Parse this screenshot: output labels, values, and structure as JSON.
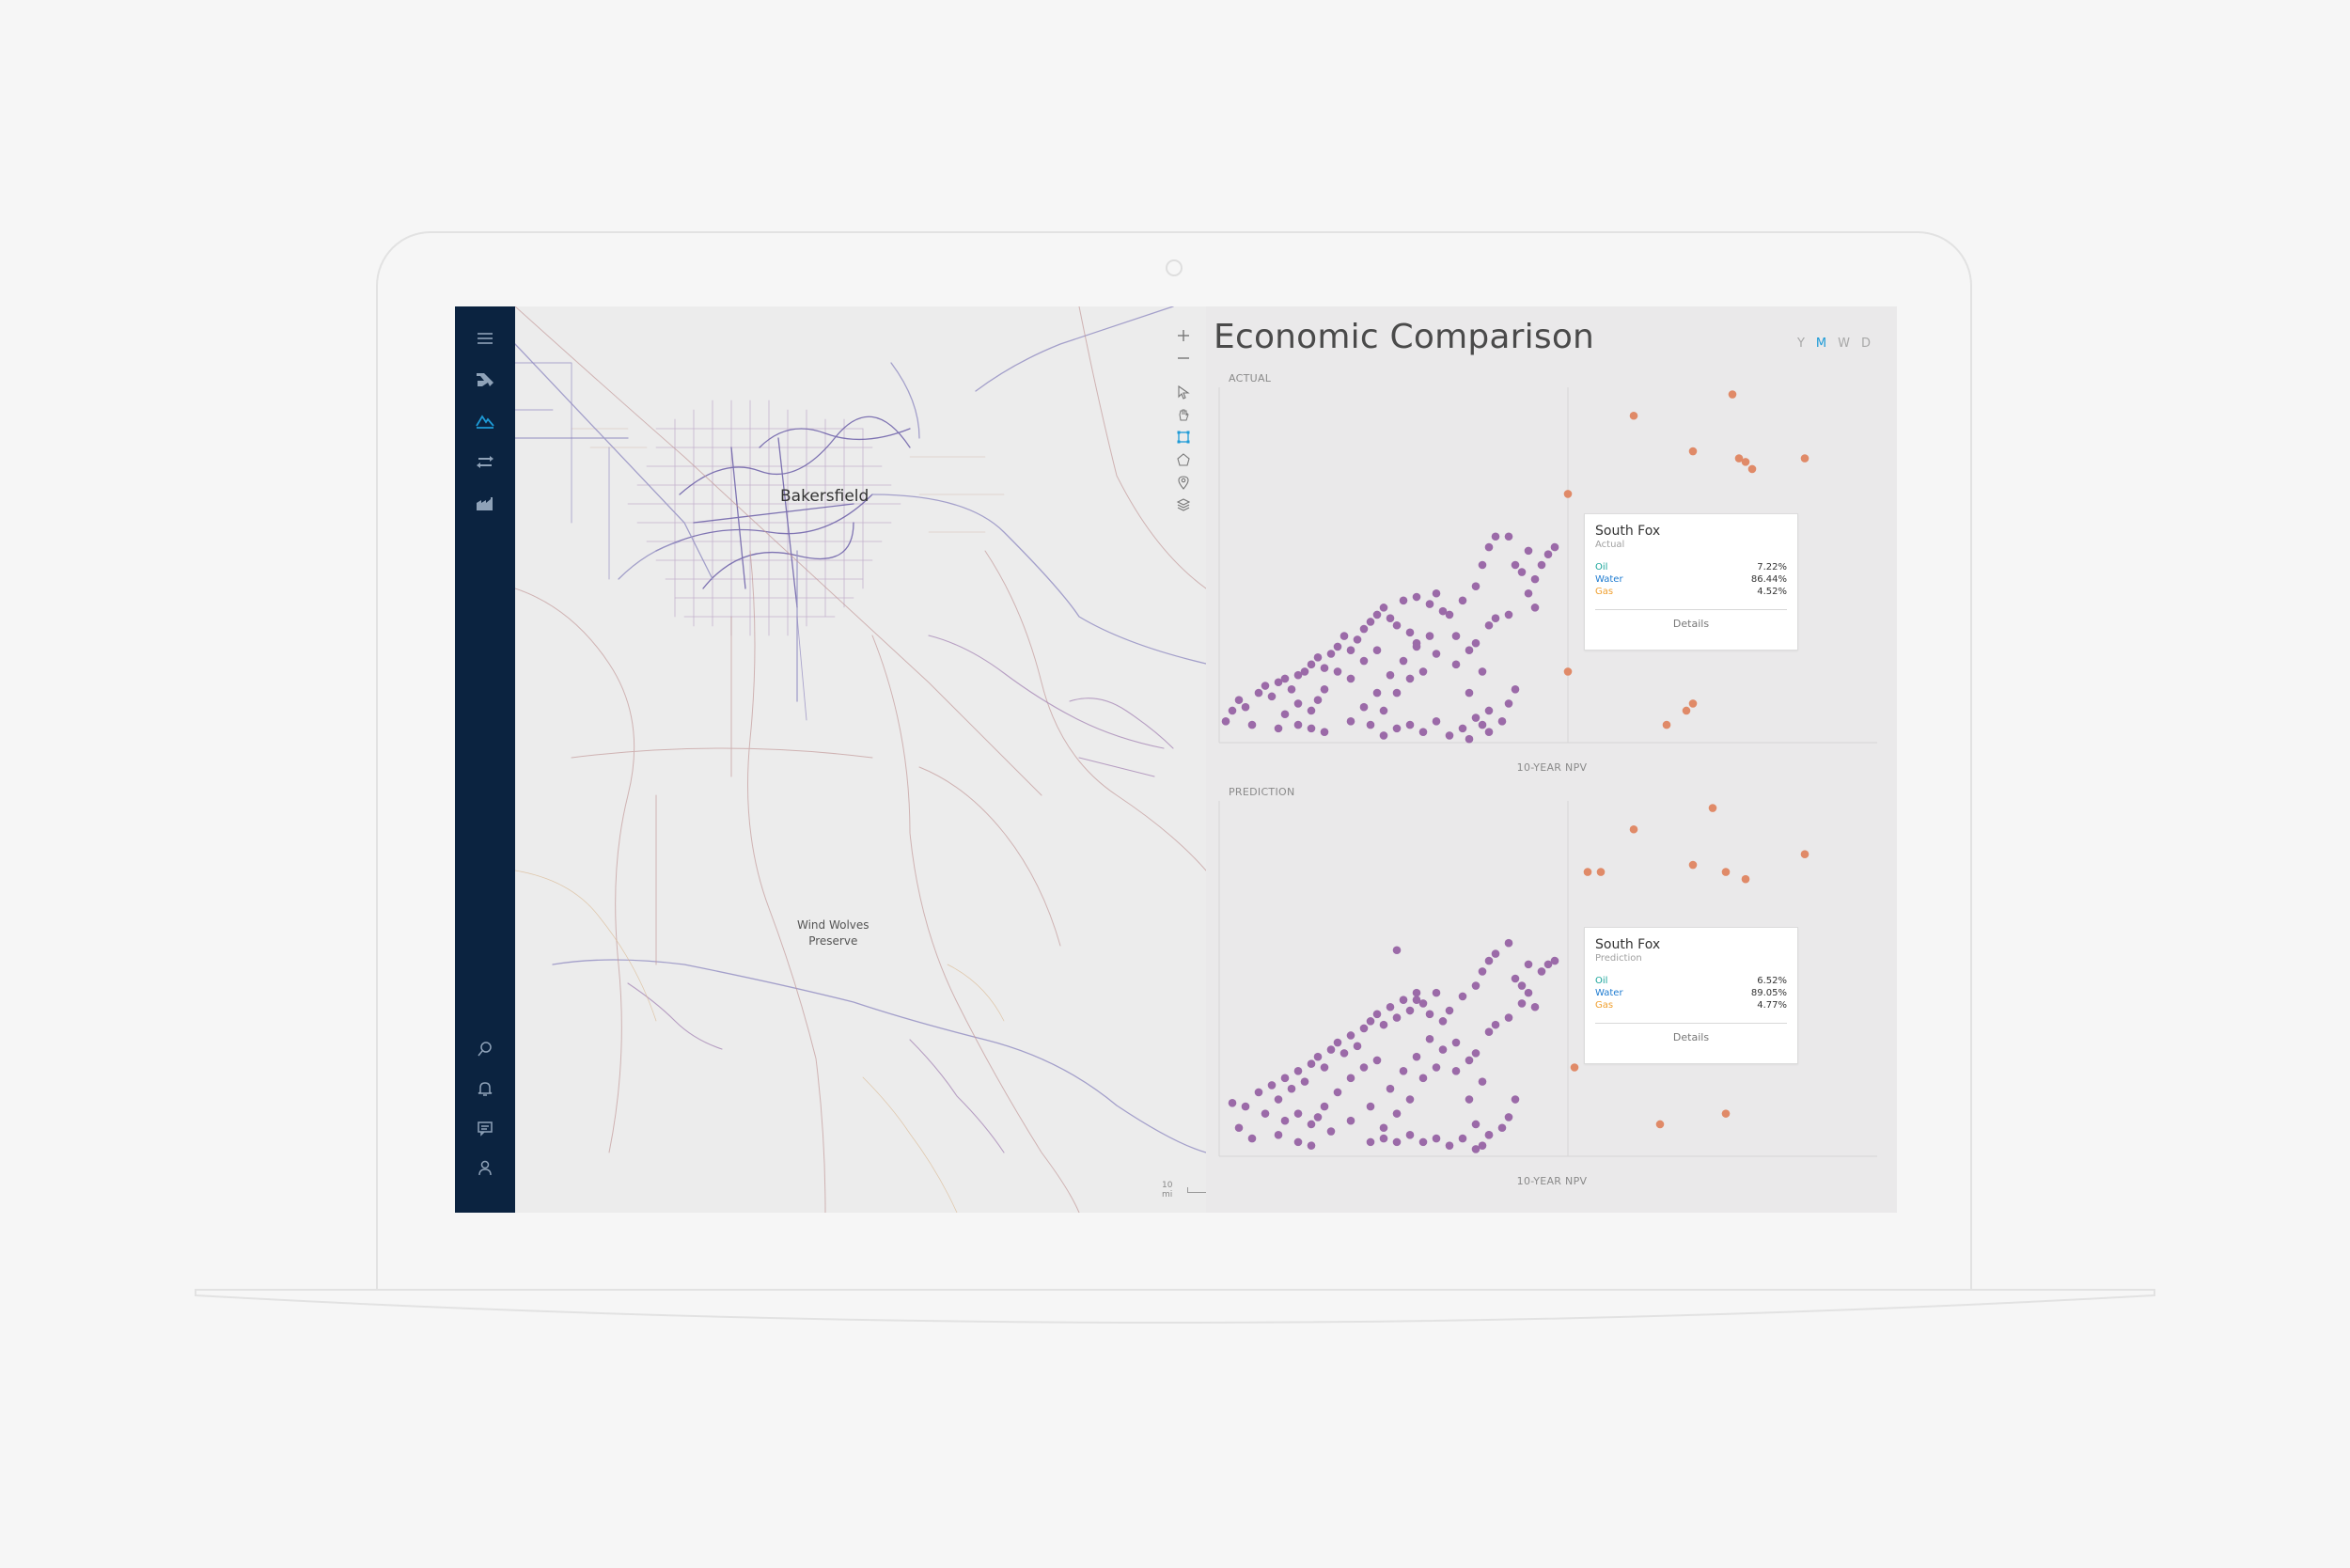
{
  "colors": {
    "sidebar_bg": "#0b2340",
    "accent": "#1e9bd7",
    "actual_dots": "#9b6aa8",
    "far_dots": "#e08a68",
    "oil": "#1aa59a",
    "water": "#1e7bd0",
    "gas": "#f0a030"
  },
  "sidebar": {
    "top_icons": [
      "menu-icon",
      "oil-rig-icon",
      "analytics-peaks-icon",
      "transfer-arrows-icon",
      "factory-icon"
    ],
    "active_icon": "analytics-peaks-icon",
    "bottom_icons": [
      "search-icon",
      "bell-icon",
      "chat-icon",
      "user-icon"
    ]
  },
  "map": {
    "city_label": "Bakersfield",
    "park_label": "Wind Wolves\nPreserve",
    "scale_label": "10 mi",
    "tools": [
      "zoom-in-icon",
      "zoom-out-icon",
      "pointer-icon",
      "pan-hand-icon",
      "rectangle-select-icon",
      "polygon-select-icon",
      "location-pin-icon",
      "layers-icon"
    ],
    "active_tool": "rectangle-select-icon"
  },
  "panel": {
    "title": "Economic Comparison",
    "periods": [
      "Y",
      "M",
      "W",
      "D"
    ],
    "active_period": "M"
  },
  "chart_data": [
    {
      "type": "scatter",
      "label": "ACTUAL",
      "xlabel": "10-YEAR NPV",
      "ylabel": "",
      "ylim": [
        0,
        100
      ],
      "xlim": [
        0,
        100
      ],
      "reference_line_x": 53,
      "points": [
        [
          1,
          6
        ],
        [
          2,
          9
        ],
        [
          5,
          5
        ],
        [
          3,
          12
        ],
        [
          6,
          14
        ],
        [
          4,
          10
        ],
        [
          7,
          16
        ],
        [
          8,
          13
        ],
        [
          9,
          17
        ],
        [
          10,
          18
        ],
        [
          11,
          15
        ],
        [
          12,
          19
        ],
        [
          13,
          20
        ],
        [
          14,
          22
        ],
        [
          15,
          24
        ],
        [
          16,
          21
        ],
        [
          17,
          25
        ],
        [
          18,
          27
        ],
        [
          19,
          30
        ],
        [
          20,
          26
        ],
        [
          21,
          29
        ],
        [
          22,
          32
        ],
        [
          23,
          34
        ],
        [
          24,
          36
        ],
        [
          25,
          38
        ],
        [
          26,
          35
        ],
        [
          27,
          33
        ],
        [
          28,
          40
        ],
        [
          29,
          31
        ],
        [
          30,
          28
        ],
        [
          24,
          26
        ],
        [
          22,
          23
        ],
        [
          20,
          18
        ],
        [
          18,
          20
        ],
        [
          16,
          15
        ],
        [
          15,
          12
        ],
        [
          14,
          9
        ],
        [
          12,
          11
        ],
        [
          10,
          8
        ],
        [
          9,
          4
        ],
        [
          12,
          5
        ],
        [
          14,
          4
        ],
        [
          16,
          3
        ],
        [
          20,
          6
        ],
        [
          22,
          10
        ],
        [
          24,
          14
        ],
        [
          26,
          19
        ],
        [
          28,
          23
        ],
        [
          30,
          27
        ],
        [
          32,
          30
        ],
        [
          33,
          25
        ],
        [
          31,
          20
        ],
        [
          29,
          18
        ],
        [
          27,
          14
        ],
        [
          25,
          9
        ],
        [
          23,
          5
        ],
        [
          25,
          2
        ],
        [
          27,
          4
        ],
        [
          29,
          5
        ],
        [
          31,
          3
        ],
        [
          33,
          6
        ],
        [
          35,
          2
        ],
        [
          37,
          4
        ],
        [
          39,
          7
        ],
        [
          41,
          9
        ],
        [
          43,
          6
        ],
        [
          44,
          11
        ],
        [
          45,
          15
        ],
        [
          40,
          20
        ],
        [
          38,
          26
        ],
        [
          36,
          30
        ],
        [
          34,
          37
        ],
        [
          32,
          39
        ],
        [
          30,
          41
        ],
        [
          33,
          42
        ],
        [
          35,
          36
        ],
        [
          37,
          40
        ],
        [
          39,
          44
        ],
        [
          40,
          50
        ],
        [
          41,
          55
        ],
        [
          42,
          58
        ],
        [
          36,
          22
        ],
        [
          38,
          14
        ],
        [
          39,
          28
        ],
        [
          41,
          33
        ],
        [
          42,
          35
        ],
        [
          44,
          36
        ],
        [
          47,
          42
        ],
        [
          48,
          46
        ],
        [
          49,
          50
        ],
        [
          50,
          53
        ],
        [
          51,
          55
        ],
        [
          47,
          54
        ],
        [
          44,
          58
        ],
        [
          45,
          50
        ],
        [
          46,
          48
        ],
        [
          48,
          38
        ],
        [
          41,
          3
        ],
        [
          40,
          5
        ],
        [
          38,
          1
        ]
      ],
      "far_points": [
        [
          53,
          70
        ],
        [
          53,
          20
        ],
        [
          63,
          92
        ],
        [
          68,
          5
        ],
        [
          72,
          82
        ],
        [
          78,
          98
        ],
        [
          79,
          80
        ],
        [
          78,
          63
        ],
        [
          80,
          79
        ],
        [
          81,
          77
        ],
        [
          89,
          80
        ],
        [
          71,
          9
        ],
        [
          72,
          11
        ]
      ],
      "tooltip": {
        "title": "South Fox",
        "subtitle": "Actual",
        "rows": [
          {
            "name": "Oil",
            "value": "7.22%"
          },
          {
            "name": "Water",
            "value": "86.44%"
          },
          {
            "name": "Gas",
            "value": "4.52%"
          }
        ],
        "action": "Details"
      }
    },
    {
      "type": "scatter",
      "label": "PREDICTION",
      "xlabel": "10-YEAR NPV",
      "ylabel": "",
      "ylim": [
        0,
        100
      ],
      "xlim": [
        0,
        100
      ],
      "reference_line_x": 53,
      "points": [
        [
          2,
          15
        ],
        [
          3,
          8
        ],
        [
          5,
          5
        ],
        [
          4,
          14
        ],
        [
          6,
          18
        ],
        [
          7,
          12
        ],
        [
          8,
          20
        ],
        [
          9,
          16
        ],
        [
          10,
          22
        ],
        [
          11,
          19
        ],
        [
          12,
          24
        ],
        [
          13,
          21
        ],
        [
          14,
          26
        ],
        [
          15,
          28
        ],
        [
          16,
          25
        ],
        [
          17,
          30
        ],
        [
          18,
          32
        ],
        [
          19,
          29
        ],
        [
          20,
          34
        ],
        [
          21,
          31
        ],
        [
          22,
          36
        ],
        [
          23,
          38
        ],
        [
          24,
          40
        ],
        [
          25,
          37
        ],
        [
          26,
          42
        ],
        [
          27,
          39
        ],
        [
          28,
          44
        ],
        [
          29,
          41
        ],
        [
          30,
          46
        ],
        [
          31,
          43
        ],
        [
          24,
          27
        ],
        [
          22,
          25
        ],
        [
          20,
          22
        ],
        [
          18,
          18
        ],
        [
          16,
          14
        ],
        [
          15,
          11
        ],
        [
          14,
          9
        ],
        [
          12,
          12
        ],
        [
          10,
          10
        ],
        [
          9,
          6
        ],
        [
          12,
          4
        ],
        [
          14,
          3
        ],
        [
          17,
          7
        ],
        [
          20,
          10
        ],
        [
          23,
          14
        ],
        [
          26,
          19
        ],
        [
          28,
          24
        ],
        [
          30,
          28
        ],
        [
          32,
          33
        ],
        [
          34,
          30
        ],
        [
          33,
          25
        ],
        [
          31,
          22
        ],
        [
          29,
          16
        ],
        [
          27,
          12
        ],
        [
          25,
          8
        ],
        [
          23,
          4
        ],
        [
          25,
          5
        ],
        [
          27,
          4
        ],
        [
          29,
          6
        ],
        [
          31,
          4
        ],
        [
          33,
          5
        ],
        [
          35,
          3
        ],
        [
          37,
          5
        ],
        [
          39,
          9
        ],
        [
          41,
          6
        ],
        [
          43,
          8
        ],
        [
          44,
          11
        ],
        [
          45,
          16
        ],
        [
          40,
          21
        ],
        [
          38,
          27
        ],
        [
          36,
          32
        ],
        [
          34,
          38
        ],
        [
          32,
          40
        ],
        [
          30,
          44
        ],
        [
          33,
          46
        ],
        [
          35,
          41
        ],
        [
          37,
          45
        ],
        [
          39,
          48
        ],
        [
          40,
          52
        ],
        [
          41,
          55
        ],
        [
          42,
          57
        ],
        [
          36,
          24
        ],
        [
          38,
          16
        ],
        [
          39,
          29
        ],
        [
          41,
          35
        ],
        [
          42,
          37
        ],
        [
          44,
          39
        ],
        [
          46,
          43
        ],
        [
          47,
          46
        ],
        [
          49,
          52
        ],
        [
          50,
          54
        ],
        [
          51,
          55
        ],
        [
          47,
          54
        ],
        [
          44,
          60
        ],
        [
          45,
          50
        ],
        [
          46,
          48
        ],
        [
          48,
          42
        ],
        [
          41,
          6
        ],
        [
          40,
          3
        ],
        [
          39,
          2
        ],
        [
          27,
          58
        ]
      ],
      "far_points": [
        [
          58,
          80
        ],
        [
          63,
          92
        ],
        [
          67,
          9
        ],
        [
          72,
          82
        ],
        [
          75,
          98
        ],
        [
          77,
          12
        ],
        [
          77,
          80
        ],
        [
          80,
          78
        ],
        [
          78,
          63
        ],
        [
          89,
          85
        ],
        [
          54,
          25
        ],
        [
          56,
          80
        ]
      ],
      "tooltip": {
        "title": "South Fox",
        "subtitle": "Prediction",
        "rows": [
          {
            "name": "Oil",
            "value": "6.52%"
          },
          {
            "name": "Water",
            "value": "89.05%"
          },
          {
            "name": "Gas",
            "value": "4.77%"
          }
        ],
        "action": "Details"
      }
    }
  ]
}
